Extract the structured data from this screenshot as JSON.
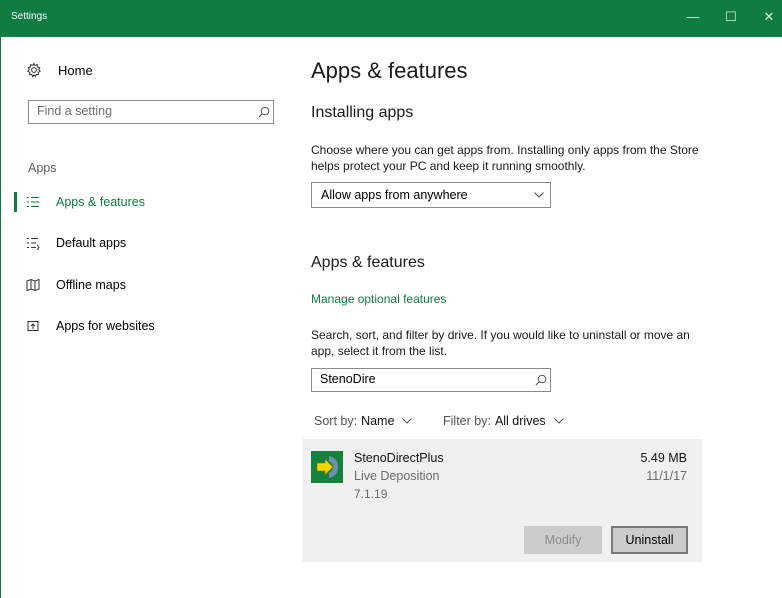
{
  "window": {
    "title": "Settings",
    "accent": "#107c41",
    "controls": {
      "minimize": "—",
      "maximize": "☐",
      "close": "✕"
    }
  },
  "sidebar": {
    "home_label": "Home",
    "search_placeholder": "Find a setting",
    "section_header": "Apps",
    "items": [
      {
        "label": "Apps & features",
        "icon": "apps-list-icon",
        "active": true
      },
      {
        "label": "Default apps",
        "icon": "default-apps-icon",
        "active": false
      },
      {
        "label": "Offline maps",
        "icon": "map-icon",
        "active": false
      },
      {
        "label": "Apps for websites",
        "icon": "web-app-icon",
        "active": false
      }
    ]
  },
  "main": {
    "page_title": "Apps & features",
    "installing": {
      "heading": "Installing apps",
      "description": "Choose where you can get apps from. Installing only apps from the Store helps protect your PC and keep it running smoothly.",
      "dropdown_value": "Allow apps from anywhere"
    },
    "features": {
      "heading": "Apps & features",
      "manage_link": "Manage optional features",
      "description": "Search, sort, and filter by drive. If you would like to uninstall or move an app, select it from the list.",
      "search_value": "StenoDire",
      "sort_label": "Sort by:",
      "sort_value": "Name",
      "filter_label": "Filter by:",
      "filter_value": "All drives"
    },
    "app": {
      "name": "StenoDirectPlus",
      "publisher": "Live Deposition",
      "version": "7.1.19",
      "size": "5.49 MB",
      "date": "11/1/17",
      "modify_label": "Modify",
      "uninstall_label": "Uninstall"
    }
  }
}
